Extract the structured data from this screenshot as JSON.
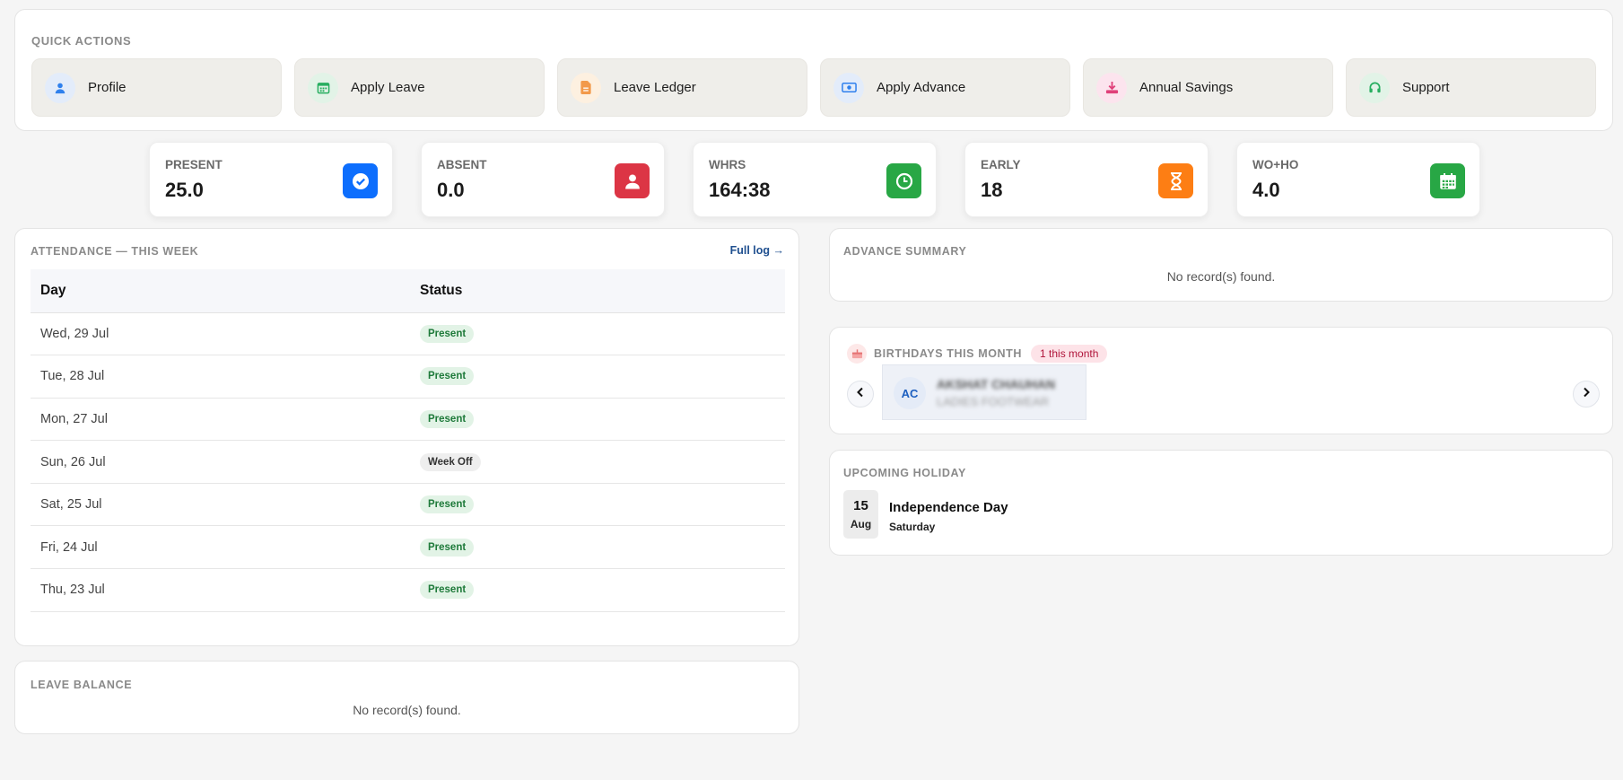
{
  "quick_actions": {
    "title": "QUICK ACTIONS",
    "items": [
      {
        "label": "Profile",
        "icon": "user-icon",
        "color": "#2f80ed",
        "bg": "#e3ecfa"
      },
      {
        "label": "Apply Leave",
        "icon": "calendar-icon",
        "color": "#27ae60",
        "bg": "#e2f3e7"
      },
      {
        "label": "Leave Ledger",
        "icon": "document-icon",
        "color": "#f2994a",
        "bg": "#fdf0e0"
      },
      {
        "label": "Apply Advance",
        "icon": "money-icon",
        "color": "#2f80ed",
        "bg": "#e3ecfa"
      },
      {
        "label": "Annual Savings",
        "icon": "download-icon",
        "color": "#e0407a",
        "bg": "#fce4ee"
      },
      {
        "label": "Support",
        "icon": "headset-icon",
        "color": "#27ae60",
        "bg": "#e2f3e7"
      }
    ]
  },
  "stats": [
    {
      "label": "PRESENT",
      "value": "25.0",
      "icon": "check-circle-icon",
      "color": "#0d6efd"
    },
    {
      "label": "ABSENT",
      "value": "0.0",
      "icon": "user-icon",
      "color": "#dc3545"
    },
    {
      "label": "WHRS",
      "value": "164:38",
      "icon": "clock-icon",
      "color": "#28a745"
    },
    {
      "label": "EARLY",
      "value": "18",
      "icon": "hourglass-icon",
      "color": "#fd7e14"
    },
    {
      "label": "WO+HO",
      "value": "4.0",
      "icon": "calendar-icon",
      "color": "#28a745"
    }
  ],
  "attendance": {
    "title": "ATTENDANCE — THIS WEEK",
    "full_log": "Full log →",
    "columns": [
      "Day",
      "Status"
    ],
    "rows": [
      {
        "day": "Wed, 29 Jul",
        "status": "Present"
      },
      {
        "day": "Tue, 28 Jul",
        "status": "Present"
      },
      {
        "day": "Mon, 27 Jul",
        "status": "Present"
      },
      {
        "day": "Sun, 26 Jul",
        "status": "Week Off"
      },
      {
        "day": "Sat, 25 Jul",
        "status": "Present"
      },
      {
        "day": "Fri, 24 Jul",
        "status": "Present"
      },
      {
        "day": "Thu, 23 Jul",
        "status": "Present"
      }
    ]
  },
  "leave_balance": {
    "title": "LEAVE BALANCE",
    "empty": "No record(s) found."
  },
  "advance_summary": {
    "title": "ADVANCE SUMMARY",
    "empty": "No record(s) found."
  },
  "birthdays": {
    "title": "BIRTHDAYS THIS MONTH",
    "badge": "1 this month",
    "person": {
      "initials": "AC",
      "name": "AKSHAT CHAUHAN",
      "dept": "LADIES FOOTWEAR"
    }
  },
  "holiday": {
    "title": "UPCOMING HOLIDAY",
    "day": "15",
    "month": "Aug",
    "name": "Independence Day",
    "weekday": "Saturday"
  }
}
